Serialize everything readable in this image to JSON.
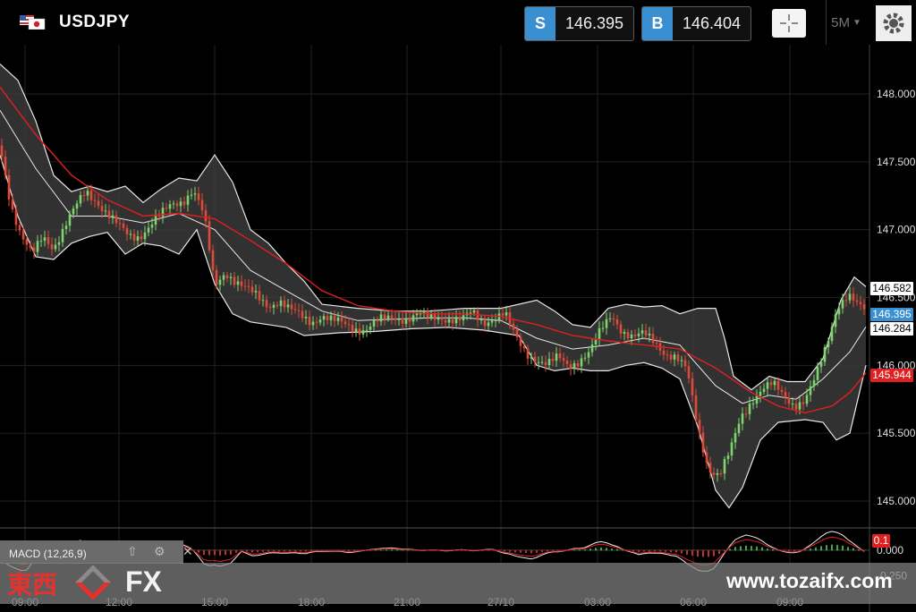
{
  "instrument": {
    "symbol": "USDJPY"
  },
  "quotes": {
    "sell_label": "S",
    "sell_price": "146.395",
    "buy_label": "B",
    "buy_price": "146.404"
  },
  "toolbar": {
    "timeframe": "5M"
  },
  "price_axis": {
    "ticks": [
      "148.000",
      "147.500",
      "147.000",
      "146.500",
      "146.000",
      "145.500",
      "145.000"
    ]
  },
  "time_axis": {
    "ticks": [
      "09:00",
      "12:00",
      "15:00",
      "18:00",
      "21:00",
      "27/10",
      "03:00",
      "06:00",
      "09:00"
    ]
  },
  "price_tags": {
    "upper_band": "146.582",
    "sell": "146.395",
    "middle_band": "146.284",
    "moving_average": "145.944"
  },
  "macd": {
    "label": "MACD (12,26,9)",
    "ticks": [
      "0.000",
      "-0.250"
    ],
    "value_tag": "0.1"
  },
  "watermark": {
    "logo_text": "東西",
    "fx_text": "FX",
    "url": "www.tozaifx.com"
  },
  "colors": {
    "sell": "#3a8fd0",
    "buy": "#3a8fd0",
    "ma": "#e02020",
    "band": "#dddddd",
    "bullish": "#7fd36f",
    "bearish": "#e04a3a"
  },
  "chart_data": {
    "type": "candlestick",
    "interval": "5M",
    "ylim": [
      144.8,
      148.3
    ],
    "x_ticks": [
      "09:00",
      "12:00",
      "15:00",
      "18:00",
      "21:00",
      "27/10",
      "03:00",
      "06:00",
      "09:00"
    ],
    "y_ticks": [
      148.0,
      147.5,
      147.0,
      146.5,
      146.0,
      145.5,
      145.0
    ],
    "close_path": [
      [
        0,
        147.62
      ],
      [
        12,
        147.2
      ],
      [
        24,
        146.95
      ],
      [
        36,
        146.8
      ],
      [
        48,
        146.95
      ],
      [
        60,
        146.88
      ],
      [
        72,
        147.02
      ],
      [
        84,
        147.15
      ],
      [
        96,
        147.28
      ],
      [
        108,
        147.22
      ],
      [
        120,
        147.12
      ],
      [
        132,
        147.02
      ],
      [
        144,
        146.95
      ],
      [
        156,
        146.96
      ],
      [
        168,
        147.04
      ],
      [
        180,
        147.1
      ],
      [
        192,
        147.18
      ],
      [
        204,
        147.22
      ],
      [
        216,
        147.3
      ],
      [
        228,
        147.1
      ],
      [
        240,
        146.58
      ],
      [
        252,
        146.7
      ],
      [
        264,
        146.62
      ],
      [
        276,
        146.55
      ],
      [
        288,
        146.5
      ],
      [
        300,
        146.45
      ],
      [
        312,
        146.48
      ],
      [
        324,
        146.4
      ],
      [
        336,
        146.36
      ],
      [
        348,
        146.33
      ],
      [
        360,
        146.37
      ],
      [
        372,
        146.32
      ],
      [
        384,
        146.3
      ],
      [
        396,
        146.28
      ],
      [
        408,
        146.27
      ],
      [
        420,
        146.31
      ],
      [
        432,
        146.34
      ],
      [
        444,
        146.36
      ],
      [
        456,
        146.35
      ],
      [
        468,
        146.37
      ],
      [
        480,
        146.34
      ],
      [
        492,
        146.36
      ],
      [
        504,
        146.35
      ],
      [
        516,
        146.33
      ],
      [
        528,
        146.38
      ],
      [
        540,
        146.32
      ],
      [
        552,
        146.36
      ],
      [
        564,
        146.38
      ],
      [
        576,
        146.2
      ],
      [
        588,
        146.1
      ],
      [
        600,
        146.05
      ],
      [
        612,
        146.0
      ],
      [
        624,
        146.05
      ],
      [
        636,
        146.0
      ],
      [
        648,
        146.05
      ],
      [
        660,
        146.1
      ],
      [
        672,
        146.25
      ],
      [
        684,
        146.38
      ],
      [
        696,
        146.26
      ],
      [
        708,
        146.2
      ],
      [
        720,
        146.22
      ],
      [
        732,
        146.18
      ],
      [
        744,
        146.1
      ],
      [
        756,
        146.05
      ],
      [
        768,
        145.95
      ],
      [
        780,
        145.55
      ],
      [
        792,
        145.25
      ],
      [
        804,
        145.18
      ],
      [
        816,
        145.35
      ],
      [
        828,
        145.62
      ],
      [
        840,
        145.75
      ],
      [
        852,
        145.82
      ],
      [
        864,
        145.85
      ],
      [
        876,
        145.78
      ],
      [
        888,
        145.72
      ],
      [
        900,
        145.74
      ],
      [
        912,
        145.9
      ],
      [
        924,
        146.15
      ],
      [
        936,
        146.45
      ],
      [
        948,
        146.52
      ],
      [
        960,
        146.42
      ],
      [
        968,
        146.4
      ]
    ],
    "moving_average_path": [
      [
        0,
        148.05
      ],
      [
        40,
        147.7
      ],
      [
        80,
        147.4
      ],
      [
        120,
        147.22
      ],
      [
        160,
        147.1
      ],
      [
        200,
        147.12
      ],
      [
        240,
        147.08
      ],
      [
        280,
        146.92
      ],
      [
        320,
        146.75
      ],
      [
        360,
        146.55
      ],
      [
        400,
        146.44
      ],
      [
        440,
        146.4
      ],
      [
        480,
        146.38
      ],
      [
        520,
        146.38
      ],
      [
        560,
        146.36
      ],
      [
        600,
        146.3
      ],
      [
        640,
        146.22
      ],
      [
        680,
        146.18
      ],
      [
        720,
        146.15
      ],
      [
        760,
        146.12
      ],
      [
        800,
        145.98
      ],
      [
        840,
        145.8
      ],
      [
        870,
        145.7
      ],
      [
        900,
        145.65
      ],
      [
        930,
        145.7
      ],
      [
        950,
        145.8
      ],
      [
        968,
        145.944
      ]
    ],
    "bollinger": {
      "upper": [
        [
          0,
          148.22
        ],
        [
          20,
          148.1
        ],
        [
          40,
          147.8
        ],
        [
          60,
          147.4
        ],
        [
          80,
          147.28
        ],
        [
          100,
          147.32
        ],
        [
          120,
          147.28
        ],
        [
          140,
          147.32
        ],
        [
          160,
          147.2
        ],
        [
          180,
          147.3
        ],
        [
          200,
          147.38
        ],
        [
          220,
          147.36
        ],
        [
          240,
          147.55
        ],
        [
          260,
          147.35
        ],
        [
          280,
          147.0
        ],
        [
          300,
          146.9
        ],
        [
          320,
          146.75
        ],
        [
          340,
          146.62
        ],
        [
          360,
          146.45
        ],
        [
          400,
          146.42
        ],
        [
          440,
          146.4
        ],
        [
          480,
          146.4
        ],
        [
          520,
          146.42
        ],
        [
          560,
          146.42
        ],
        [
          600,
          146.48
        ],
        [
          620,
          146.4
        ],
        [
          640,
          146.3
        ],
        [
          660,
          146.28
        ],
        [
          680,
          146.42
        ],
        [
          700,
          146.45
        ],
        [
          720,
          146.43
        ],
        [
          740,
          146.44
        ],
        [
          760,
          146.38
        ],
        [
          780,
          146.42
        ],
        [
          800,
          146.42
        ],
        [
          810,
          146.2
        ],
        [
          820,
          145.92
        ],
        [
          840,
          145.82
        ],
        [
          860,
          145.92
        ],
        [
          880,
          145.88
        ],
        [
          900,
          145.88
        ],
        [
          920,
          146.05
        ],
        [
          940,
          146.48
        ],
        [
          955,
          146.65
        ],
        [
          968,
          146.58
        ]
      ],
      "middle": [
        [
          0,
          147.88
        ],
        [
          40,
          147.45
        ],
        [
          80,
          147.1
        ],
        [
          120,
          147.1
        ],
        [
          160,
          147.05
        ],
        [
          200,
          147.12
        ],
        [
          240,
          147.0
        ],
        [
          280,
          146.7
        ],
        [
          320,
          146.55
        ],
        [
          360,
          146.4
        ],
        [
          400,
          146.33
        ],
        [
          440,
          146.34
        ],
        [
          480,
          146.35
        ],
        [
          520,
          146.35
        ],
        [
          560,
          146.33
        ],
        [
          600,
          146.2
        ],
        [
          640,
          146.12
        ],
        [
          680,
          146.15
        ],
        [
          720,
          146.2
        ],
        [
          760,
          146.15
        ],
        [
          800,
          145.85
        ],
        [
          830,
          145.72
        ],
        [
          860,
          145.78
        ],
        [
          890,
          145.75
        ],
        [
          920,
          145.9
        ],
        [
          950,
          146.1
        ],
        [
          968,
          146.284
        ]
      ],
      "lower": [
        [
          0,
          147.55
        ],
        [
          20,
          147.1
        ],
        [
          40,
          146.8
        ],
        [
          60,
          146.78
        ],
        [
          80,
          146.9
        ],
        [
          100,
          146.95
        ],
        [
          120,
          146.98
        ],
        [
          140,
          146.82
        ],
        [
          160,
          146.9
        ],
        [
          180,
          146.88
        ],
        [
          200,
          146.82
        ],
        [
          220,
          147.0
        ],
        [
          240,
          146.6
        ],
        [
          260,
          146.38
        ],
        [
          280,
          146.32
        ],
        [
          300,
          146.3
        ],
        [
          320,
          146.28
        ],
        [
          340,
          146.22
        ],
        [
          380,
          146.24
        ],
        [
          420,
          146.25
        ],
        [
          460,
          146.27
        ],
        [
          500,
          146.28
        ],
        [
          540,
          146.26
        ],
        [
          580,
          146.22
        ],
        [
          600,
          146.0
        ],
        [
          620,
          145.96
        ],
        [
          640,
          145.98
        ],
        [
          660,
          145.96
        ],
        [
          680,
          145.96
        ],
        [
          700,
          146.0
        ],
        [
          720,
          146.02
        ],
        [
          740,
          145.98
        ],
        [
          760,
          145.9
        ],
        [
          780,
          145.55
        ],
        [
          800,
          145.08
        ],
        [
          815,
          144.95
        ],
        [
          830,
          145.1
        ],
        [
          850,
          145.45
        ],
        [
          870,
          145.58
        ],
        [
          900,
          145.6
        ],
        [
          920,
          145.58
        ],
        [
          935,
          145.45
        ],
        [
          950,
          145.5
        ],
        [
          968,
          146.0
        ]
      ]
    },
    "macd_ylim": [
      -0.35,
      0.2
    ]
  }
}
